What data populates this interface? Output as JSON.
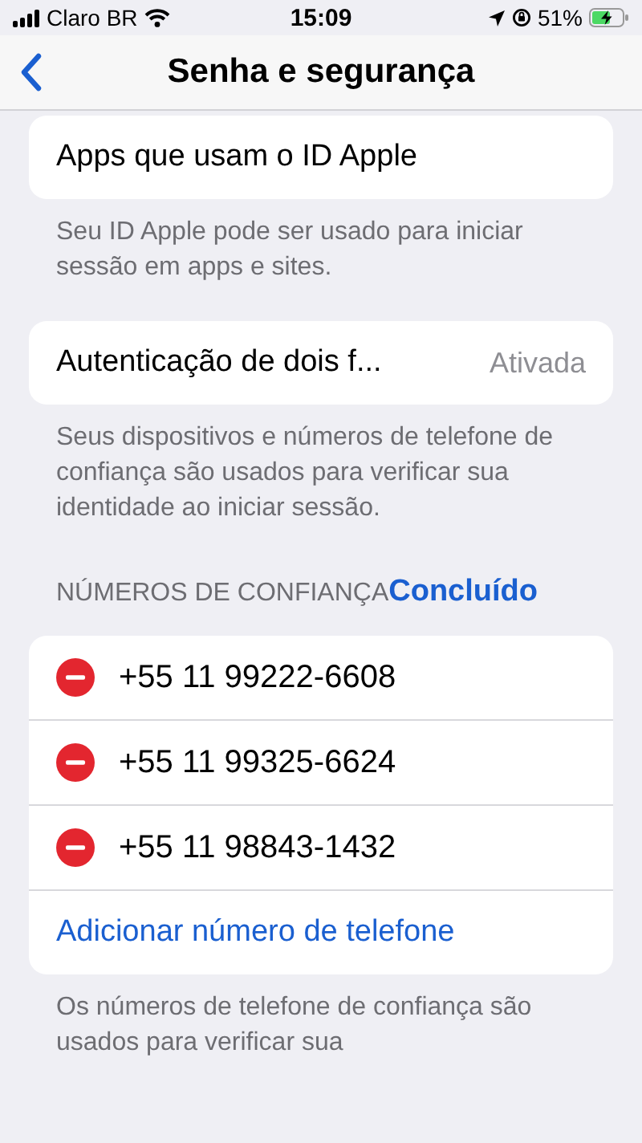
{
  "status_bar": {
    "carrier": "Claro BR",
    "time": "15:09",
    "battery": "51%"
  },
  "nav": {
    "title": "Senha e segurança"
  },
  "sections": [
    {
      "rows": [
        {
          "kind": "label",
          "label": "Apps que usam o ID Apple"
        }
      ],
      "footer": "Seu ID Apple pode ser usado para iniciar sessão em apps e sites."
    },
    {
      "rows": [
        {
          "kind": "value",
          "label": "Autenticação de dois f...",
          "value": "Ativada"
        }
      ],
      "footer": "Seus dispositivos e números de telefone de confiança são usados para verificar sua identidade ao iniciar sessão."
    },
    {
      "header": "NÚMEROS DE CONFIANÇA",
      "header_action": "Concluído",
      "rows": [
        {
          "kind": "phone",
          "label": "+55 11 99222-6608"
        },
        {
          "kind": "phone",
          "label": "+55 11 99325-6624"
        },
        {
          "kind": "phone",
          "label": "+55 11 98843-1432"
        },
        {
          "kind": "link",
          "label": "Adicionar número de telefone"
        }
      ],
      "footer": "Os números de telefone de confiança são usados para verificar sua"
    }
  ]
}
